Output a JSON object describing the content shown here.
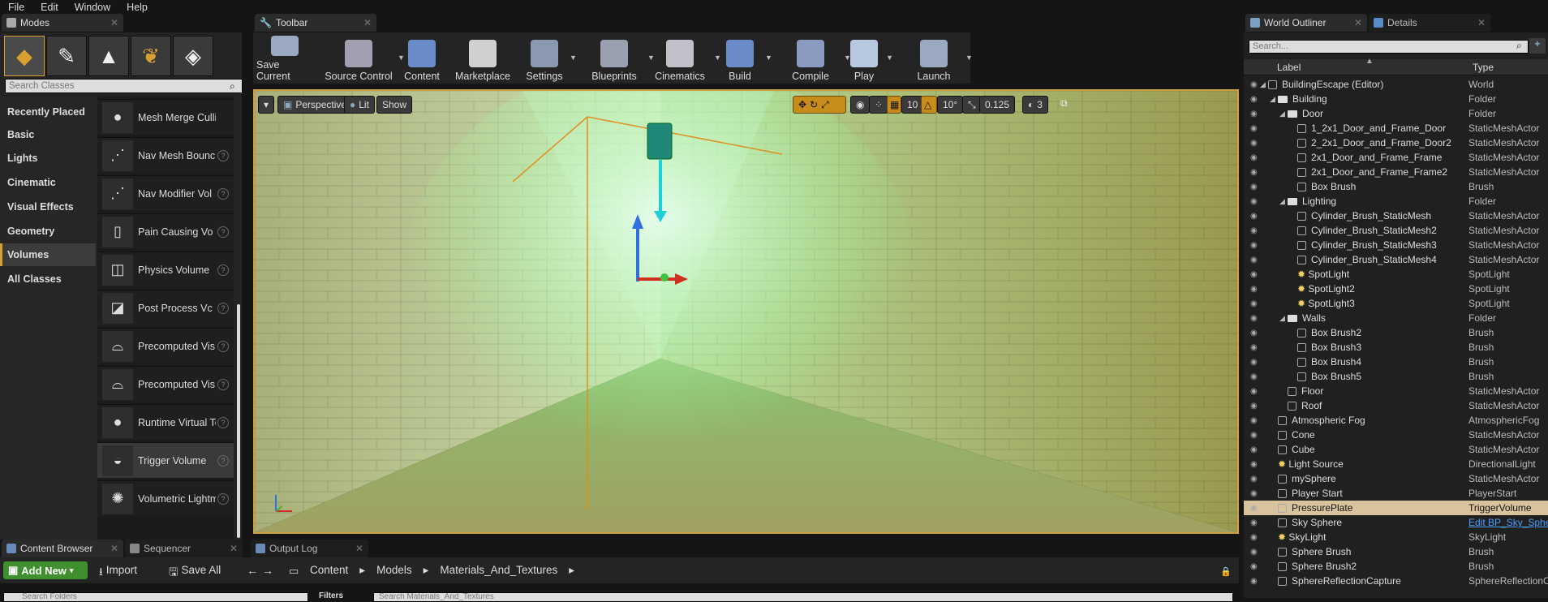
{
  "menu": [
    "File",
    "Edit",
    "Window",
    "Help"
  ],
  "tabs": {
    "modes": "Modes",
    "toolbar": "Toolbar",
    "world_outliner": "World Outliner",
    "details": "Details",
    "content_browser": "Content Browser",
    "sequencer": "Sequencer",
    "output_log": "Output Log"
  },
  "modes": {
    "search_placeholder": "Search Classes",
    "categories": [
      "Recently Placed",
      "Basic",
      "Lights",
      "Cinematic",
      "Visual Effects",
      "Geometry",
      "Volumes",
      "All Classes"
    ],
    "selected_category": "Volumes",
    "items": [
      "Mesh Merge Culling",
      "Nav Mesh Bounds Volume",
      "Nav Modifier Volume",
      "Pain Causing Volume",
      "Physics Volume",
      "Post Process Volume",
      "Precomputed Visibility Volume",
      "Precomputed Visibility Override Volume",
      "Runtime Virtual Texture Volume",
      "Trigger Volume",
      "Volumetric Lightmap Density Volume"
    ],
    "item_labels": [
      "Mesh Merge Culling",
      "Nav Mesh Bounc",
      "Nav Modifier Vol",
      "Pain Causing Vo",
      "Physics Volume",
      "Post Process Vc",
      "Precomputed Vis",
      "Precomputed Vis",
      "Runtime Virtual Tex",
      "Trigger Volume",
      "Volumetric Lightmap"
    ]
  },
  "toolbar": [
    "Save Current",
    "Source Control",
    "Content",
    "Marketplace",
    "Settings",
    "Blueprints",
    "Cinematics",
    "Build",
    "Compile",
    "Play",
    "Launch"
  ],
  "viewport": {
    "perspective": "Perspective",
    "lit": "Lit",
    "show": "Show",
    "grid_snap": "10",
    "rot_snap": "10°",
    "scale_snap": "0.125",
    "cam_speed": "3"
  },
  "content_browser": {
    "add_new": "Add New",
    "import": "Import",
    "save_all": "Save All",
    "path": [
      "Content",
      "Models",
      "Materials_And_Textures"
    ],
    "search_folders": "Search Folders",
    "filters": "Filters",
    "search_assets": "Search Materials_And_Textures"
  },
  "outliner": {
    "search_placeholder": "Search...",
    "col_label": "Label",
    "col_type": "Type",
    "rows": [
      {
        "d": 0,
        "l": "BuildingEscape (Editor)",
        "t": "World",
        "k": "world"
      },
      {
        "d": 1,
        "l": "Building",
        "t": "Folder",
        "k": "folder"
      },
      {
        "d": 2,
        "l": "Door",
        "t": "Folder",
        "k": "folder"
      },
      {
        "d": 3,
        "l": "1_2x1_Door_and_Frame_Door",
        "t": "StaticMeshActor",
        "k": "mesh"
      },
      {
        "d": 3,
        "l": "2_2x1_Door_and_Frame_Door2",
        "t": "StaticMeshActor",
        "k": "mesh"
      },
      {
        "d": 3,
        "l": "2x1_Door_and_Frame_Frame",
        "t": "StaticMeshActor",
        "k": "mesh"
      },
      {
        "d": 3,
        "l": "2x1_Door_and_Frame_Frame2",
        "t": "StaticMeshActor",
        "k": "mesh"
      },
      {
        "d": 3,
        "l": "Box Brush",
        "t": "Brush",
        "k": "mesh"
      },
      {
        "d": 2,
        "l": "Lighting",
        "t": "Folder",
        "k": "folder"
      },
      {
        "d": 3,
        "l": "Cylinder_Brush_StaticMesh",
        "t": "StaticMeshActor",
        "k": "mesh"
      },
      {
        "d": 3,
        "l": "Cylinder_Brush_StaticMesh2",
        "t": "StaticMeshActor",
        "k": "mesh"
      },
      {
        "d": 3,
        "l": "Cylinder_Brush_StaticMesh3",
        "t": "StaticMeshActor",
        "k": "mesh"
      },
      {
        "d": 3,
        "l": "Cylinder_Brush_StaticMesh4",
        "t": "StaticMeshActor",
        "k": "mesh"
      },
      {
        "d": 3,
        "l": "SpotLight",
        "t": "SpotLight",
        "k": "light"
      },
      {
        "d": 3,
        "l": "SpotLight2",
        "t": "SpotLight",
        "k": "light"
      },
      {
        "d": 3,
        "l": "SpotLight3",
        "t": "SpotLight",
        "k": "light"
      },
      {
        "d": 2,
        "l": "Walls",
        "t": "Folder",
        "k": "folder"
      },
      {
        "d": 3,
        "l": "Box Brush2",
        "t": "Brush",
        "k": "mesh"
      },
      {
        "d": 3,
        "l": "Box Brush3",
        "t": "Brush",
        "k": "mesh"
      },
      {
        "d": 3,
        "l": "Box Brush4",
        "t": "Brush",
        "k": "mesh"
      },
      {
        "d": 3,
        "l": "Box Brush5",
        "t": "Brush",
        "k": "mesh"
      },
      {
        "d": 2,
        "l": "Floor",
        "t": "StaticMeshActor",
        "k": "mesh"
      },
      {
        "d": 2,
        "l": "Roof",
        "t": "StaticMeshActor",
        "k": "mesh"
      },
      {
        "d": 1,
        "l": "Atmospheric Fog",
        "t": "AtmosphericFog",
        "k": "mesh"
      },
      {
        "d": 1,
        "l": "Cone",
        "t": "StaticMeshActor",
        "k": "mesh"
      },
      {
        "d": 1,
        "l": "Cube",
        "t": "StaticMeshActor",
        "k": "mesh"
      },
      {
        "d": 1,
        "l": "Light Source",
        "t": "DirectionalLight",
        "k": "light"
      },
      {
        "d": 1,
        "l": "mySphere",
        "t": "StaticMeshActor",
        "k": "mesh"
      },
      {
        "d": 1,
        "l": "Player Start",
        "t": "PlayerStart",
        "k": "mesh"
      },
      {
        "d": 1,
        "l": "PressurePlate",
        "t": "TriggerVolume",
        "k": "mesh",
        "sel": true
      },
      {
        "d": 1,
        "l": "Sky Sphere",
        "t": "Edit BP_Sky_Sphere",
        "k": "mesh",
        "link": true
      },
      {
        "d": 1,
        "l": "SkyLight",
        "t": "SkyLight",
        "k": "light"
      },
      {
        "d": 1,
        "l": "Sphere Brush",
        "t": "Brush",
        "k": "mesh"
      },
      {
        "d": 1,
        "l": "Sphere Brush2",
        "t": "Brush",
        "k": "mesh"
      },
      {
        "d": 1,
        "l": "SphereReflectionCapture",
        "t": "SphereReflectionCapture",
        "k": "mesh"
      }
    ]
  },
  "colors": {
    "accent": "#d8a030",
    "add_new": "#3f8f2f",
    "selected_row": "#d8c39c",
    "link": "#4aa0ff"
  }
}
